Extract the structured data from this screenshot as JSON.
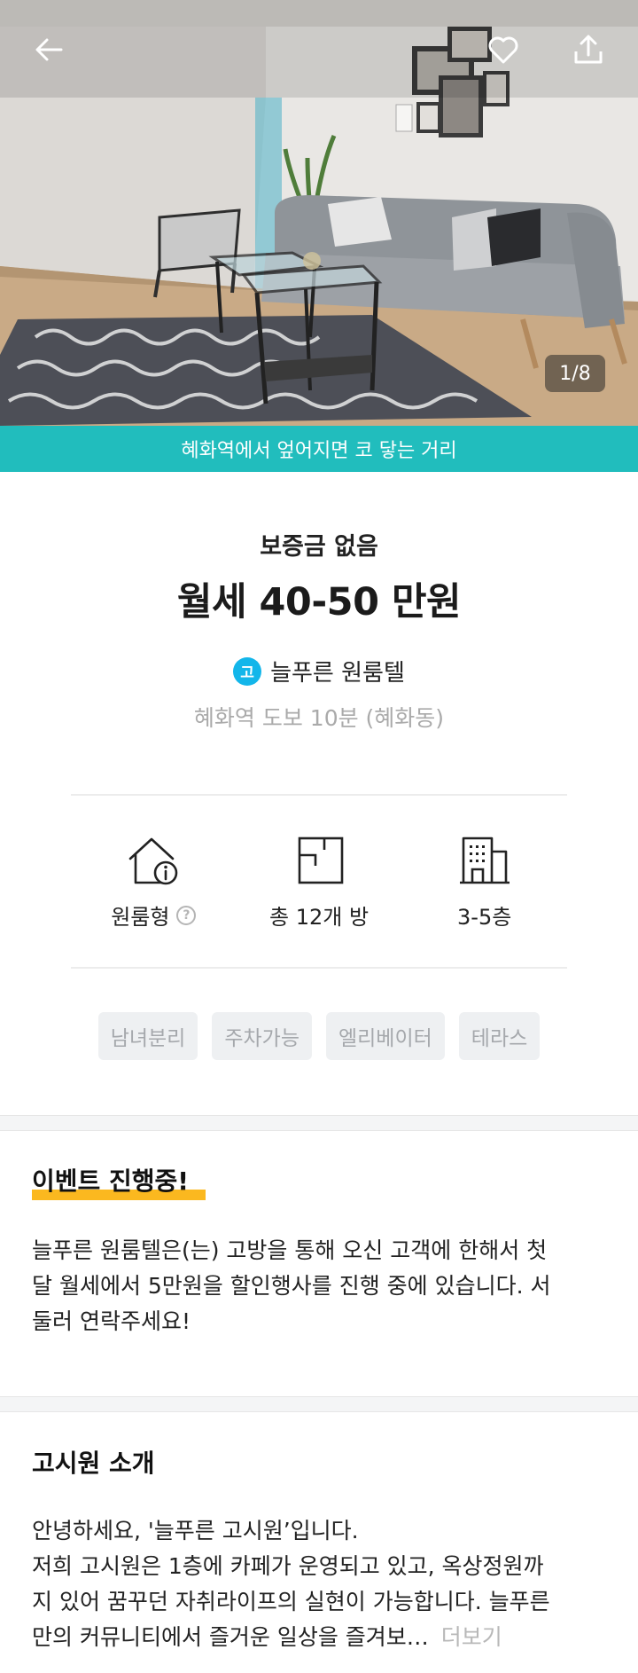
{
  "hero": {
    "photo_alt": "living room with grey sofa, glass coffee table, chair and patterned rug",
    "counter": "1/8",
    "icons": {
      "back": "arrow-left-icon",
      "favorite": "heart-icon",
      "share": "share-icon"
    }
  },
  "banner": {
    "text": "혜화역에서 엎어지면 코 닿는 거리",
    "color": "#21bdbd"
  },
  "summary": {
    "deposit": "보증금 없음",
    "rent": "월세 40-50 만원",
    "provider_badge": "고",
    "provider_name": "늘푸른 원룸텔",
    "location": "혜화역 도보 10분 (혜화동)"
  },
  "specs": [
    {
      "icon": "house-info-icon",
      "label": "원룸형",
      "help_icon": "?"
    },
    {
      "icon": "room-floorplan-icon",
      "label": "총 12개 방"
    },
    {
      "icon": "building-icon",
      "label": "3-5층"
    }
  ],
  "tags": [
    "남녀분리",
    "주차가능",
    "엘리베이터",
    "테라스"
  ],
  "event": {
    "title": "이벤트 진행중!",
    "lines": [
      "늘푸른 원룸텔은(는) 고방을 통해 오신 고객에 한해서 첫",
      "달 월세에서 5만원을 할인행사를 진행 중에 있습니다. 서",
      "둘러 연락주세요!"
    ]
  },
  "intro": {
    "title": "고시원 소개",
    "lines": [
      "안녕하세요, '늘푸른 고시원’입니다.",
      "저희 고시원은 1층에 카페가 운영되고 있고, 옥상정원까",
      "지 있어 꿈꾸던 자취라이프의 실현이 가능합니다. 늘푸른",
      "만의 커뮤니티에서 즐거운 일상을 즐겨보…"
    ],
    "more": "더보기"
  },
  "colors": {
    "accent_teal": "#21bdbd",
    "badge_blue": "#13b6ea",
    "highlight": "#fbb81f"
  }
}
